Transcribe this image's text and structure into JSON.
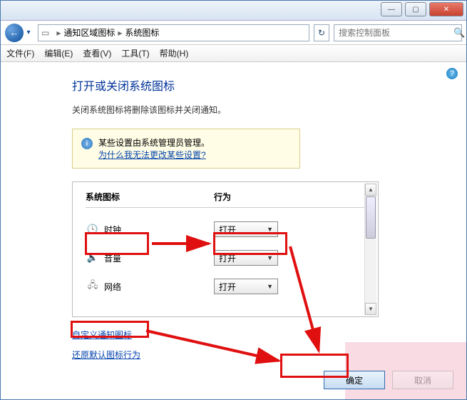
{
  "titlebar": {
    "min": "—",
    "max": "▢",
    "close": "✕"
  },
  "addressbar": {
    "back": "←",
    "drop": "▾",
    "path1": "通知区域图标",
    "path2": "系统图标",
    "sep": "▸",
    "refresh": "↻",
    "search_placeholder": "搜索控制面板",
    "search_icon": "🔍"
  },
  "menu": {
    "file": "文件(F)",
    "edit": "编辑(E)",
    "view": "查看(V)",
    "tools": "工具(T)",
    "help": "帮助(H)"
  },
  "help_icon": "?",
  "heading": "打开或关闭系统图标",
  "description": "关闭系统图标将删除该图标并关闭通知。",
  "infobox": {
    "icon": "i",
    "line1": "某些设置由系统管理员管理。",
    "link": "为什么我无法更改某些设置?"
  },
  "table": {
    "col_icon": "系统图标",
    "col_behavior": "行为",
    "rows": [
      {
        "icon": "🕓",
        "label": "时钟",
        "value": "打开"
      },
      {
        "icon": "🔈",
        "label": "音量",
        "value": "打开"
      },
      {
        "icon": "🖧",
        "label": "网络",
        "value": "打开"
      }
    ],
    "scroll_up": "▲",
    "scroll_down": "▼",
    "select_arrow": "▼"
  },
  "links": {
    "customize": "自定义通知图标",
    "restore": "还原默认图标行为"
  },
  "footer": {
    "ok": "确定",
    "cancel": "取消"
  }
}
